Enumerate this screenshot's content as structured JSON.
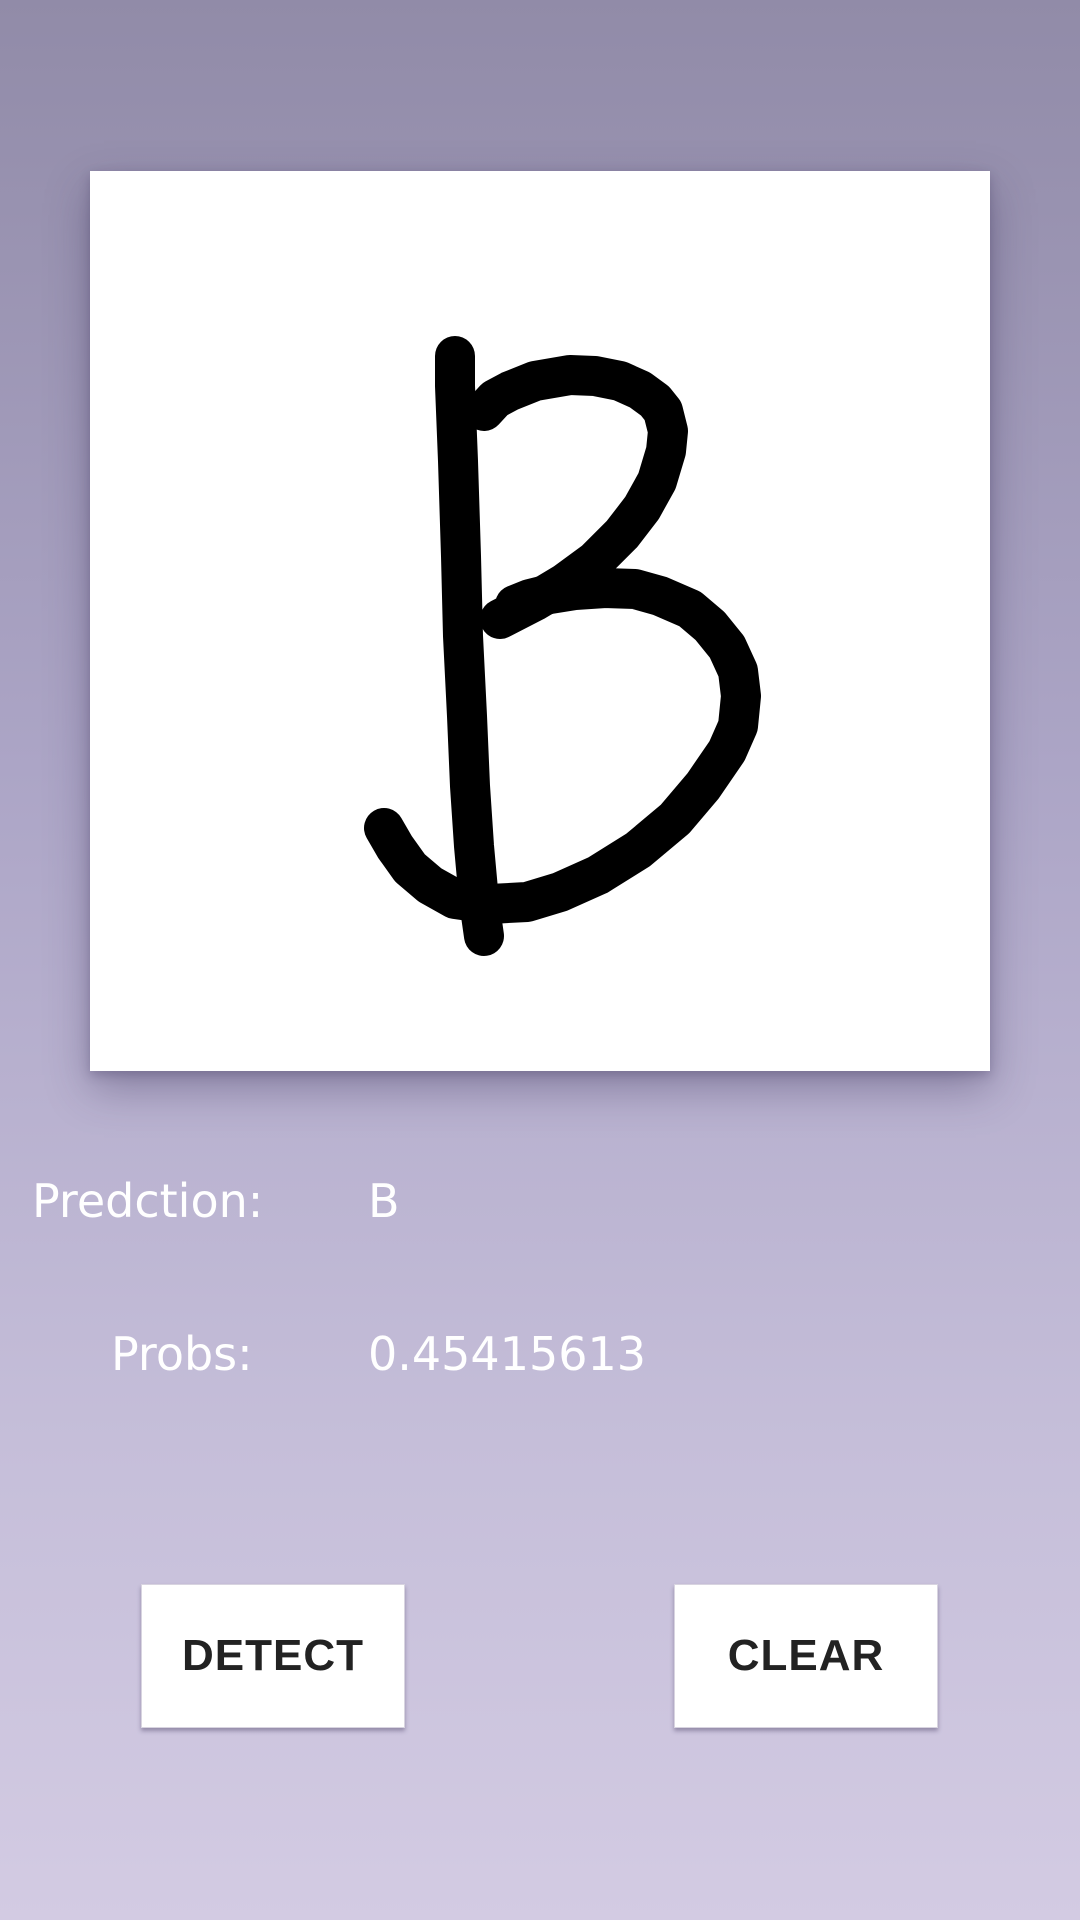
{
  "canvas": {
    "drawn_character": "B",
    "stroke_color": "#000000",
    "background_color": "#ffffff"
  },
  "results": {
    "prediction_label": "Predction:",
    "prediction_value": "B",
    "probs_label": "Probs:",
    "probs_value": "0.45415613"
  },
  "buttons": {
    "detect_label": "DETECT",
    "clear_label": "CLEAR"
  },
  "colors": {
    "background_top": "#918ba8",
    "background_bottom": "#d3cbe3",
    "text": "#ffffff",
    "button_text": "#222222"
  }
}
